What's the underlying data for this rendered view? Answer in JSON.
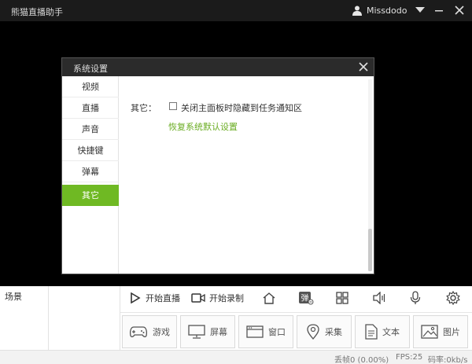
{
  "app": {
    "title": "熊猫直播助手",
    "username": "Missdodo"
  },
  "dialog": {
    "title": "系统设置",
    "nav": [
      {
        "label": "视频"
      },
      {
        "label": "直播"
      },
      {
        "label": "声音"
      },
      {
        "label": "快捷键"
      },
      {
        "label": "弹幕"
      },
      {
        "label": "其它",
        "active": true
      }
    ],
    "option_label": "其它：",
    "option_checkbox_text": "关闭主面板时隐藏到任务通知区",
    "option_checked": false,
    "restore_link": "恢复系统默认设置"
  },
  "bottom": {
    "scene_label": "场景",
    "start_live": "开始直播",
    "start_record": "开始录制",
    "toolbar_icons": [
      "home-icon",
      "danmaku-icon",
      "grid-icon",
      "speaker-icon",
      "microphone-icon",
      "settings-icon"
    ],
    "danmaku_glyph": "弹",
    "sources": [
      {
        "label": "游戏",
        "icon": "gamepad-icon"
      },
      {
        "label": "屏幕",
        "icon": "monitor-icon"
      },
      {
        "label": "窗口",
        "icon": "window-icon"
      },
      {
        "label": "采集",
        "icon": "camera-pin-icon"
      },
      {
        "label": "文本",
        "icon": "document-icon"
      },
      {
        "label": "图片",
        "icon": "image-icon"
      }
    ]
  },
  "status": {
    "dropped_frames": "丢帧0 (0.00%)",
    "fps": "FPS:25",
    "bitrate": "码率:0kb/s"
  },
  "colors": {
    "accent": "#6fb923",
    "titlebar": "#1b1b1b",
    "link": "#6aac22"
  }
}
